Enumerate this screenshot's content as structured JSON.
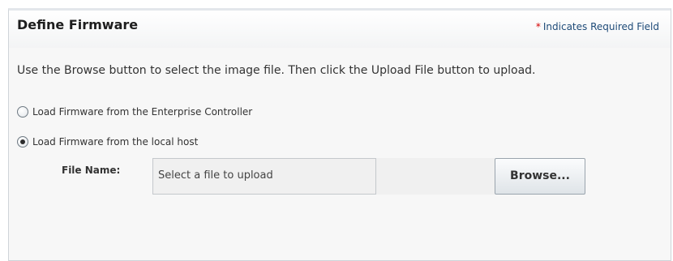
{
  "panel": {
    "title": "Define Firmware",
    "required_star": "*",
    "required_note": "Indicates Required Field"
  },
  "instructions": "Use the Browse button to select the image file. Then click the Upload File button to upload.",
  "options": [
    {
      "label": "Load Firmware from the Enterprise Controller",
      "selected": false
    },
    {
      "label": "Load Firmware from the local host",
      "selected": true
    }
  ],
  "file": {
    "label": "File Name:",
    "placeholder": "Select a file to upload",
    "browse_label": "Browse..."
  },
  "colors": {
    "required_star": "#d50000",
    "required_text": "#1e4b78"
  }
}
